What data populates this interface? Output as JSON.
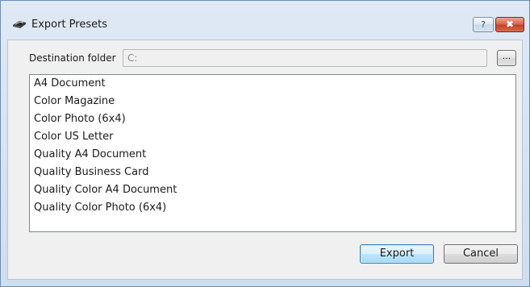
{
  "window": {
    "title": "Export Presets",
    "help_label": "?",
    "close_label": "✖"
  },
  "destination": {
    "label": "Destination folder",
    "value": "C:",
    "browse_label": "..."
  },
  "presets": [
    "A4 Document",
    "Color Magazine",
    "Color Photo (6x4)",
    "Color US Letter",
    "Quality A4 Document",
    "Quality Business Card",
    "Quality Color A4 Document",
    "Quality Color Photo (6x4)"
  ],
  "buttons": {
    "export_label": "Export",
    "cancel_label": "Cancel"
  },
  "colors": {
    "title_bar": "#dfe9f5",
    "close_button": "#c2432a",
    "default_button_border": "#3c7fb1"
  }
}
